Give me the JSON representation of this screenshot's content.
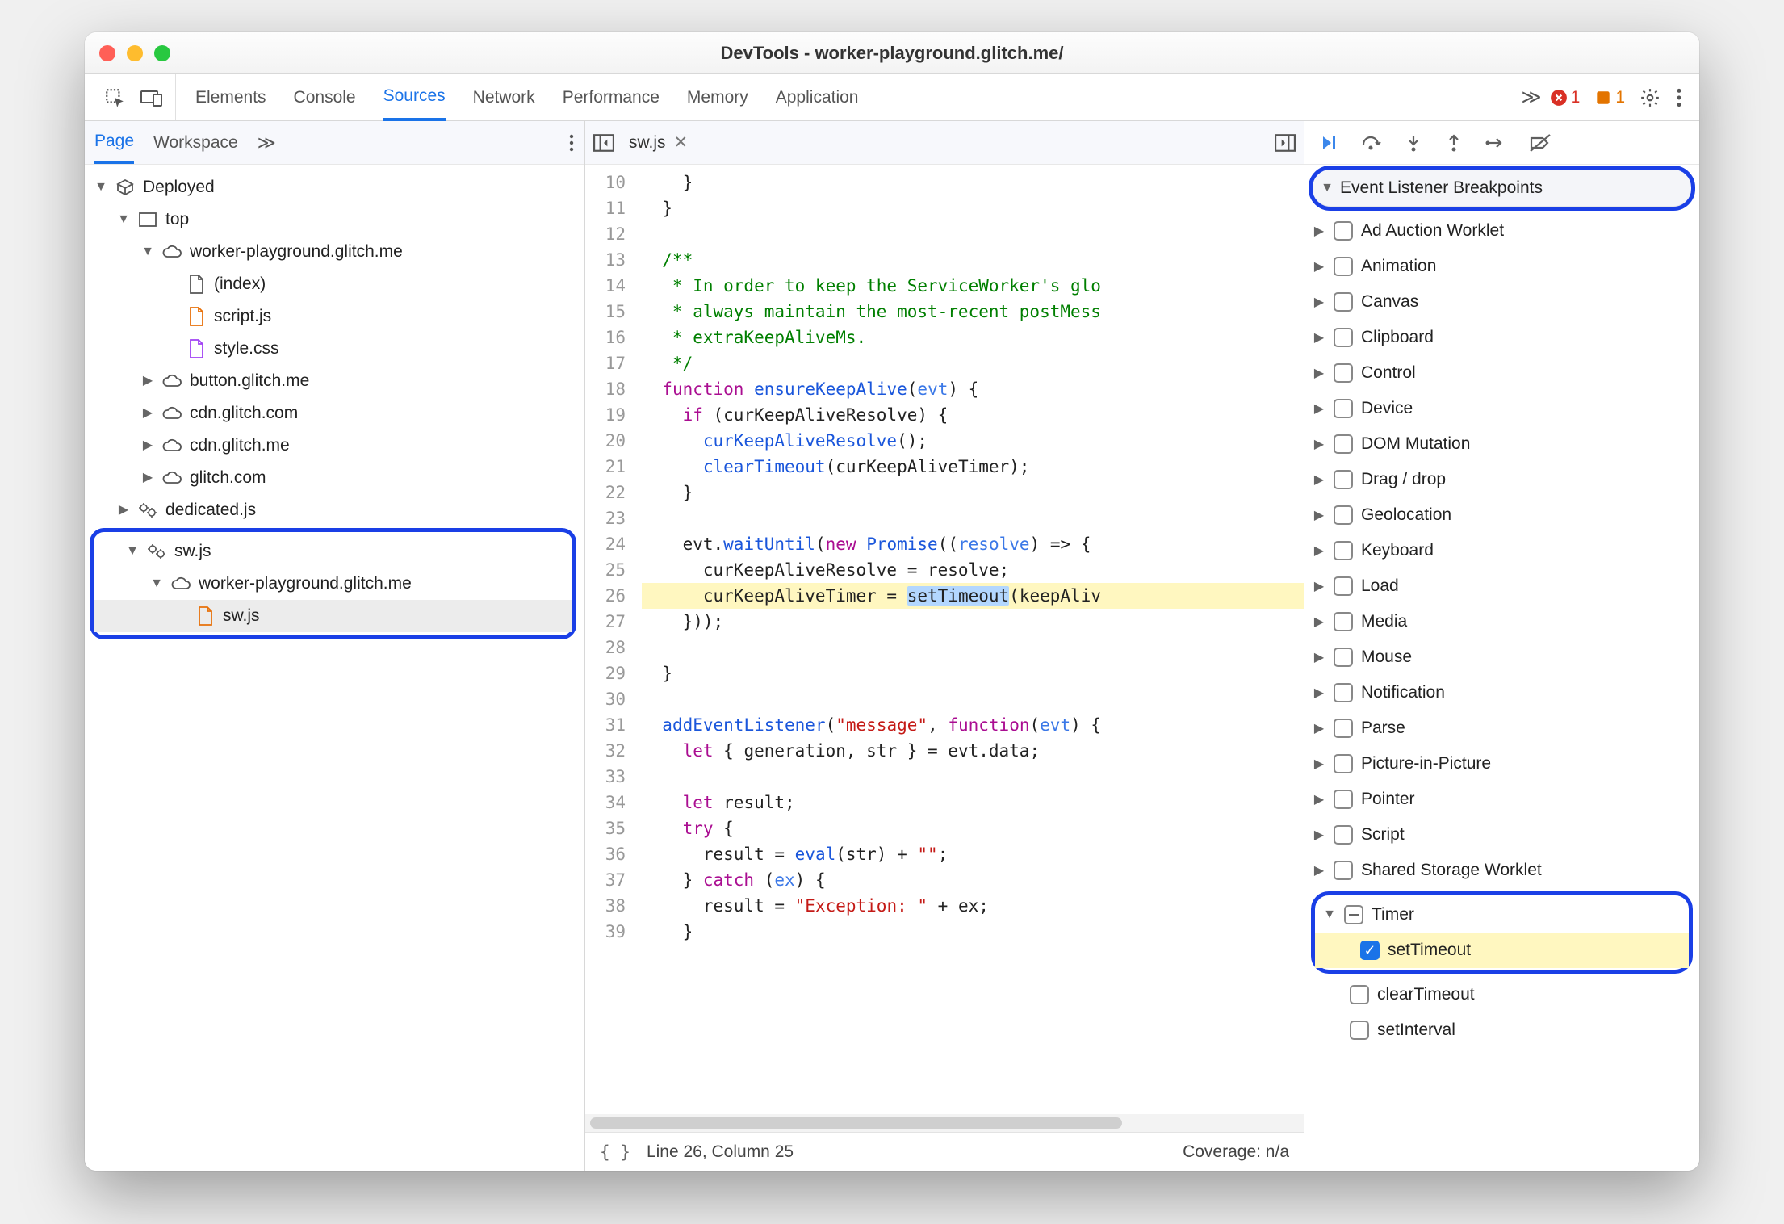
{
  "window": {
    "title": "DevTools - worker-playground.glitch.me/"
  },
  "tabs": {
    "items": [
      "Elements",
      "Console",
      "Sources",
      "Network",
      "Performance",
      "Memory",
      "Application"
    ],
    "active": "Sources",
    "more_glyph": "≫",
    "errors": "1",
    "warnings": "1"
  },
  "left": {
    "subtabs": [
      "Page",
      "Workspace"
    ],
    "subtab_active": "Page",
    "more_glyph": "≫",
    "tree": [
      {
        "depth": 0,
        "tw": "▼",
        "icon": "cube",
        "label": "Deployed"
      },
      {
        "depth": 1,
        "tw": "▼",
        "icon": "frame",
        "label": "top"
      },
      {
        "depth": 2,
        "tw": "▼",
        "icon": "cloud",
        "label": "worker-playground.glitch.me"
      },
      {
        "depth": 3,
        "tw": "",
        "icon": "file",
        "label": "(index)",
        "color": ""
      },
      {
        "depth": 3,
        "tw": "",
        "icon": "file",
        "label": "script.js",
        "color": "orange"
      },
      {
        "depth": 3,
        "tw": "",
        "icon": "file",
        "label": "style.css",
        "color": "purple"
      },
      {
        "depth": 2,
        "tw": "▶",
        "icon": "cloud",
        "label": "button.glitch.me"
      },
      {
        "depth": 2,
        "tw": "▶",
        "icon": "cloud",
        "label": "cdn.glitch.com"
      },
      {
        "depth": 2,
        "tw": "▶",
        "icon": "cloud",
        "label": "cdn.glitch.me"
      },
      {
        "depth": 2,
        "tw": "▶",
        "icon": "cloud",
        "label": "glitch.com"
      },
      {
        "depth": 1,
        "tw": "▶",
        "icon": "gears",
        "label": "dedicated.js"
      }
    ],
    "tree_hl": [
      {
        "depth": 1,
        "tw": "▼",
        "icon": "gears",
        "label": "sw.js"
      },
      {
        "depth": 2,
        "tw": "▼",
        "icon": "cloud",
        "label": "worker-playground.glitch.me"
      },
      {
        "depth": 3,
        "tw": "",
        "icon": "file",
        "label": "sw.js",
        "color": "orange",
        "selected": true
      }
    ]
  },
  "editor": {
    "file": "sw.js",
    "first_line": 10,
    "status_line": "Line 26, Column 25",
    "coverage": "Coverage: n/a",
    "lines": [
      {
        "n": 10,
        "html": "    }"
      },
      {
        "n": 11,
        "html": "  }"
      },
      {
        "n": 12,
        "html": ""
      },
      {
        "n": 13,
        "html": "  <span class='cm'>/**</span>"
      },
      {
        "n": 14,
        "html": "<span class='cm'>   * In order to keep the ServiceWorker's glo</span>"
      },
      {
        "n": 15,
        "html": "<span class='cm'>   * always maintain the most-recent postMess</span>"
      },
      {
        "n": 16,
        "html": "<span class='cm'>   * extraKeepAliveMs.</span>"
      },
      {
        "n": 17,
        "html": "<span class='cm'>   */</span>"
      },
      {
        "n": 18,
        "html": "  <span class='kw'>function</span> <span class='fn'>ensureKeepAlive</span>(<span class='id'>evt</span>) {"
      },
      {
        "n": 19,
        "html": "    <span class='kw'>if</span> (curKeepAliveResolve) {"
      },
      {
        "n": 20,
        "html": "      <span class='fn'>curKeepAliveResolve</span>();"
      },
      {
        "n": 21,
        "html": "      <span class='fn'>clearTimeout</span>(curKeepAliveTimer);"
      },
      {
        "n": 22,
        "html": "    }"
      },
      {
        "n": 23,
        "html": ""
      },
      {
        "n": 24,
        "html": "    evt.<span class='fn'>waitUntil</span>(<span class='kw'>new</span> <span class='fn'>Promise</span>((<span class='id'>resolve</span>) <span class='op'>=&gt;</span> {"
      },
      {
        "n": 25,
        "html": "      curKeepAliveResolve = resolve;"
      },
      {
        "n": 26,
        "hl": true,
        "html": "      curKeepAliveTimer = <span class='code-sel'>setTimeout</span>(keepAliv"
      },
      {
        "n": 27,
        "html": "    }));"
      },
      {
        "n": 28,
        "html": ""
      },
      {
        "n": 29,
        "html": "  }"
      },
      {
        "n": 30,
        "html": ""
      },
      {
        "n": 31,
        "html": "  <span class='fn'>addEventListener</span>(<span class='str'>\"message\"</span>, <span class='kw'>function</span>(<span class='id'>evt</span>) {"
      },
      {
        "n": 32,
        "html": "    <span class='kw'>let</span> { generation, str } = evt.data;"
      },
      {
        "n": 33,
        "html": ""
      },
      {
        "n": 34,
        "html": "    <span class='kw'>let</span> result;"
      },
      {
        "n": 35,
        "html": "    <span class='kw'>try</span> {"
      },
      {
        "n": 36,
        "html": "      result = <span class='fn'>eval</span>(str) + <span class='str'>\"\"</span>;"
      },
      {
        "n": 37,
        "html": "    } <span class='kw'>catch</span> (<span class='id'>ex</span>) {"
      },
      {
        "n": 38,
        "html": "      result = <span class='str'>\"Exception: \"</span> + ex;"
      },
      {
        "n": 39,
        "html": "    }"
      }
    ]
  },
  "right": {
    "panel_title": "Event Listener Breakpoints",
    "categories": [
      "Ad Auction Worklet",
      "Animation",
      "Canvas",
      "Clipboard",
      "Control",
      "Device",
      "DOM Mutation",
      "Drag / drop",
      "Geolocation",
      "Keyboard",
      "Load",
      "Media",
      "Mouse",
      "Notification",
      "Parse",
      "Picture-in-Picture",
      "Pointer",
      "Script",
      "Shared Storage Worklet"
    ],
    "timer": {
      "label": "Timer",
      "children": [
        {
          "label": "setTimeout",
          "checked": true,
          "hl": true
        },
        {
          "label": "clearTimeout",
          "checked": false
        },
        {
          "label": "setInterval",
          "checked": false
        }
      ]
    }
  }
}
